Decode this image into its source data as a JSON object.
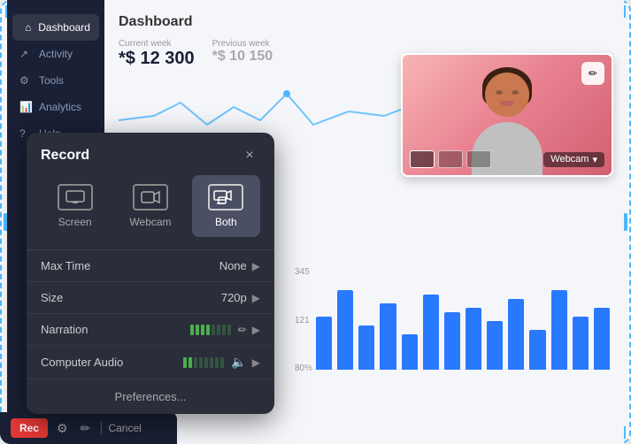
{
  "app": {
    "title": "Dashboard",
    "border_color": "#4db8ff"
  },
  "sidebar": {
    "items": [
      {
        "label": "Dashboard",
        "active": true,
        "icon": "home"
      },
      {
        "label": "Activity",
        "active": false,
        "icon": "activity"
      },
      {
        "label": "Tools",
        "active": false,
        "icon": "tools"
      },
      {
        "label": "Analytics",
        "active": false,
        "icon": "analytics"
      },
      {
        "label": "Help",
        "active": false,
        "icon": "help"
      }
    ]
  },
  "dashboard": {
    "title": "Dashboard",
    "current_week_label": "Current week",
    "current_value": "*$ 12 300",
    "previous_week_label": "Previous week",
    "previous_value": "*$ 10 150"
  },
  "webcam": {
    "label": "Webcam",
    "edit_icon": "✏"
  },
  "move_icon": "⊕",
  "record_modal": {
    "title": "Record",
    "close": "×",
    "types": [
      {
        "label": "Screen",
        "active": false,
        "icon": "screen"
      },
      {
        "label": "Webcam",
        "active": false,
        "icon": "webcam"
      },
      {
        "label": "Both",
        "active": true,
        "icon": "both"
      }
    ],
    "settings": [
      {
        "label": "Max Time",
        "value": "None",
        "has_arrow": true
      },
      {
        "label": "Size",
        "value": "720p",
        "has_arrow": true
      },
      {
        "label": "Narration",
        "value": "",
        "has_volume": true,
        "has_pencil": true,
        "has_arrow": true
      },
      {
        "label": "Computer Audio",
        "value": "",
        "has_volume": true,
        "has_speaker": true,
        "has_arrow": true
      }
    ],
    "preferences_label": "Preferences...",
    "narration_label": "Narration",
    "computer_audio_label": "Computer Audio",
    "max_time_label": "Max Time",
    "max_time_value": "None",
    "size_label": "Size",
    "size_value": "720p"
  },
  "bottom_bar": {
    "rec_label": "Rec",
    "cancel_label": "Cancel"
  },
  "bar_chart": {
    "bars": [
      0.6,
      0.9,
      0.5,
      0.75,
      0.4,
      0.85,
      0.65,
      0.7,
      0.55,
      0.8,
      0.45,
      0.9,
      0.6,
      0.7
    ],
    "labels": [
      "345",
      "121",
      "80%"
    ]
  }
}
